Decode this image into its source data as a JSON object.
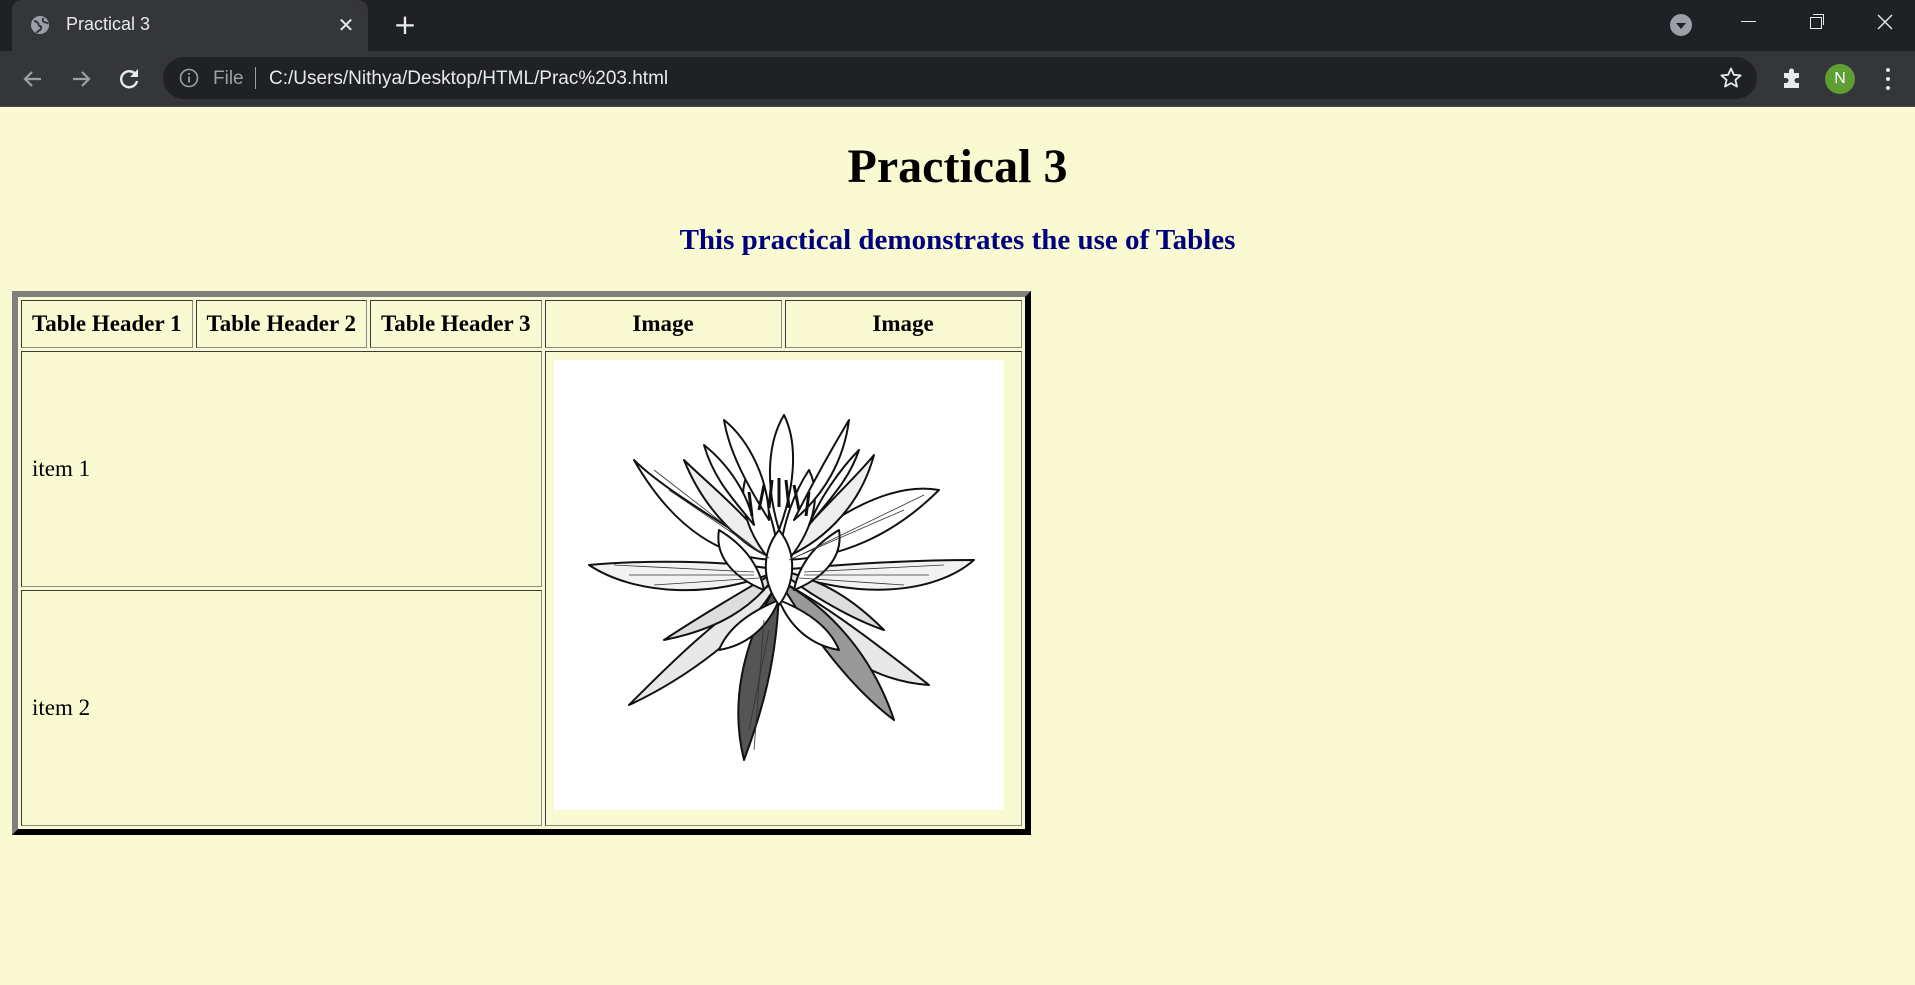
{
  "browser": {
    "tab_title": "Practical 3",
    "file_label": "File",
    "url": "C:/Users/Nithya/Desktop/HTML/Prac%203.html",
    "avatar_letter": "N",
    "avatar_color": "#5f9e33",
    "icons": [
      "globe-icon",
      "close-icon",
      "plus-icon",
      "tab-search-icon",
      "minimize-icon",
      "restore-icon",
      "window-close-icon",
      "back-arrow-icon",
      "forward-arrow-icon",
      "reload-icon",
      "info-icon",
      "star-icon",
      "puzzle-extension-icon",
      "kebab-menu-icon"
    ]
  },
  "page": {
    "background": "#f9f9d2",
    "title": "Practical 3",
    "subtitle": "This practical demonstrates the use of Tables",
    "subtitle_color": "#00007f",
    "table": {
      "headers": [
        "Table Header 1",
        "Table Header 2",
        "Table Header 3",
        "Image",
        "Image"
      ],
      "rows": [
        "item 1",
        "item 2"
      ],
      "image_subject": "lotus-flower-drawing"
    }
  }
}
